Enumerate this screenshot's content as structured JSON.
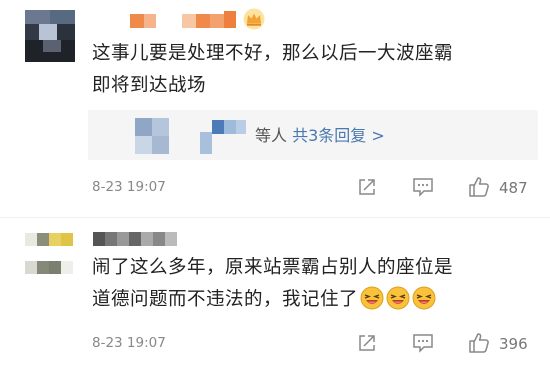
{
  "comments": [
    {
      "text_line1": "这事儿要是处理不好，那么以后一大波座霸",
      "text_line2": "即将到达战场",
      "reply_suffix": "等人",
      "reply_count": "共3条回复 >",
      "timestamp": "8-23 19:07",
      "likes": "487"
    },
    {
      "text_line1": "闹了这么多年，原来站票霸占别人的座位是",
      "text_line2": "道德问题而不违法的，我记住了",
      "timestamp": "8-23 19:07",
      "likes": "396"
    }
  ],
  "colors": {
    "reply_link": "#4a78b0",
    "meta_text": "#888888",
    "name_orange": "#f08a4b",
    "crown": "#f3b03b"
  },
  "icons": [
    "crown-icon",
    "share-icon",
    "comment-icon",
    "like-icon",
    "laughing-emoji-icon"
  ]
}
